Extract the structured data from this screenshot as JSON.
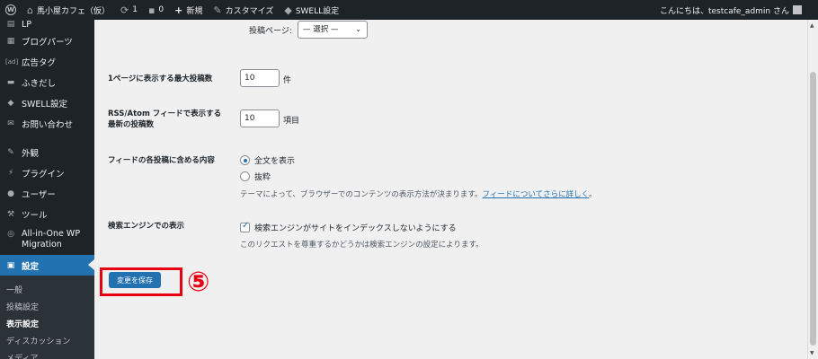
{
  "adminbar": {
    "site_name": "馬小屋カフェ（仮）",
    "updates_count": "1",
    "comments_count": "0",
    "new_label": "新規",
    "customize_label": "カスタマイズ",
    "swell_label": "SWELL設定",
    "greeting": "こんにちは、testcafe_admin さん"
  },
  "sidebar": {
    "items": [
      {
        "label": "LP",
        "icon": "page-icon"
      },
      {
        "label": "ブログパーツ",
        "icon": "blocks-icon"
      },
      {
        "label": "広告タグ",
        "icon": "ad-icon"
      },
      {
        "label": "ふきだし",
        "icon": "balloon-icon"
      },
      {
        "label": "SWELL設定",
        "icon": "swell-icon"
      },
      {
        "label": "お問い合わせ",
        "icon": "mail-icon"
      },
      {
        "label": "外観",
        "icon": "brush-icon"
      },
      {
        "label": "プラグイン",
        "icon": "plug-icon"
      },
      {
        "label": "ユーザー",
        "icon": "user-icon"
      },
      {
        "label": "ツール",
        "icon": "wrench-icon"
      },
      {
        "label": "All-in-One WP Migration",
        "icon": "migration-icon"
      },
      {
        "label": "設定",
        "icon": "settings-icon"
      }
    ],
    "submenu": [
      {
        "label": "一般"
      },
      {
        "label": "投稿設定"
      },
      {
        "label": "表示設定"
      },
      {
        "label": "ディスカッション"
      },
      {
        "label": "メディア"
      }
    ]
  },
  "main": {
    "posts_page_label": "投稿ページ:",
    "posts_page_select": "— 選択 —",
    "max_posts_label": "1ページに表示する最大投稿数",
    "max_posts_value": "10",
    "max_posts_unit": "件",
    "feed_count_label_line1": "RSS/Atom フィードで表示する",
    "feed_count_label_line2": "最新の投稿数",
    "feed_count_value": "10",
    "feed_count_unit": "項目",
    "feed_content_label": "フィードの各投稿に含める内容",
    "radio_full": "全文を表示",
    "radio_excerpt": "抜粋",
    "feed_desc": "テーマによって、ブラウザーでのコンテンツの表示方法が決まります。",
    "feed_link": "フィードについてさらに詳しく",
    "feed_desc_end": "。",
    "search_label": "検索エンジンでの表示",
    "search_checkbox": "検索エンジンがサイトをインデックスしないようにする",
    "search_desc": "このリクエストを尊重するかどうかは検索エンジンの設定によります。",
    "save_button": "変更を保存",
    "step_marker": "⑤"
  },
  "colors": {
    "accent": "#2271b1",
    "adminbar_bg": "#1d2327",
    "highlight": "#e60012"
  }
}
